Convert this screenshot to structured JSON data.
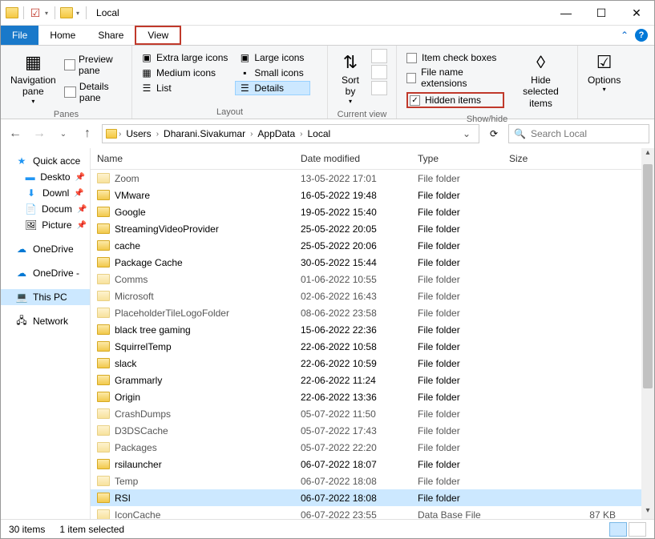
{
  "window_title": "Local",
  "menu": {
    "file": "File",
    "home": "Home",
    "share": "Share",
    "view": "View"
  },
  "ribbon": {
    "panes": {
      "navpane": "Navigation\npane",
      "preview": "Preview pane",
      "details": "Details pane",
      "group": "Panes"
    },
    "layout": {
      "xlarge": "Extra large icons",
      "large": "Large icons",
      "medium": "Medium icons",
      "small": "Small icons",
      "list": "List",
      "details": "Details",
      "group": "Layout"
    },
    "current": {
      "sort": "Sort\nby",
      "group": "Current view"
    },
    "showhide": {
      "itemcheck": "Item check boxes",
      "extensions": "File name extensions",
      "hidden": "Hidden items",
      "hideselected": "Hide selected\nitems",
      "group": "Show/hide"
    },
    "options": "Options"
  },
  "breadcrumb": [
    "Users",
    "Dharani.Sivakumar",
    "AppData",
    "Local"
  ],
  "search_placeholder": "Search Local",
  "sidebar": {
    "quick": "Quick acce",
    "quick_items": [
      "Deskto",
      "Downl",
      "Docum",
      "Picture"
    ],
    "onedrive1": "OneDrive",
    "onedrive2": "OneDrive -",
    "thispc": "This PC",
    "network": "Network"
  },
  "columns": {
    "name": "Name",
    "date": "Date modified",
    "type": "Type",
    "size": "Size"
  },
  "files": [
    {
      "name": "Zoom",
      "date": "13-05-2022 17:01",
      "type": "File folder",
      "size": "",
      "faded": true
    },
    {
      "name": "VMware",
      "date": "16-05-2022 19:48",
      "type": "File folder",
      "size": ""
    },
    {
      "name": "Google",
      "date": "19-05-2022 15:40",
      "type": "File folder",
      "size": ""
    },
    {
      "name": "StreamingVideoProvider",
      "date": "25-05-2022 20:05",
      "type": "File folder",
      "size": ""
    },
    {
      "name": "cache",
      "date": "25-05-2022 20:06",
      "type": "File folder",
      "size": ""
    },
    {
      "name": "Package Cache",
      "date": "30-05-2022 15:44",
      "type": "File folder",
      "size": ""
    },
    {
      "name": "Comms",
      "date": "01-06-2022 10:55",
      "type": "File folder",
      "size": "",
      "faded": true
    },
    {
      "name": "Microsoft",
      "date": "02-06-2022 16:43",
      "type": "File folder",
      "size": "",
      "faded": true
    },
    {
      "name": "PlaceholderTileLogoFolder",
      "date": "08-06-2022 23:58",
      "type": "File folder",
      "size": "",
      "faded": true
    },
    {
      "name": "black tree gaming",
      "date": "15-06-2022 22:36",
      "type": "File folder",
      "size": ""
    },
    {
      "name": "SquirrelTemp",
      "date": "22-06-2022 10:58",
      "type": "File folder",
      "size": ""
    },
    {
      "name": "slack",
      "date": "22-06-2022 10:59",
      "type": "File folder",
      "size": ""
    },
    {
      "name": "Grammarly",
      "date": "22-06-2022 11:24",
      "type": "File folder",
      "size": ""
    },
    {
      "name": "Origin",
      "date": "22-06-2022 13:36",
      "type": "File folder",
      "size": ""
    },
    {
      "name": "CrashDumps",
      "date": "05-07-2022 11:50",
      "type": "File folder",
      "size": "",
      "faded": true
    },
    {
      "name": "D3DSCache",
      "date": "05-07-2022 17:43",
      "type": "File folder",
      "size": "",
      "faded": true
    },
    {
      "name": "Packages",
      "date": "05-07-2022 22:20",
      "type": "File folder",
      "size": "",
      "faded": true
    },
    {
      "name": "rsilauncher",
      "date": "06-07-2022 18:07",
      "type": "File folder",
      "size": ""
    },
    {
      "name": "Temp",
      "date": "06-07-2022 18:08",
      "type": "File folder",
      "size": "",
      "faded": true
    },
    {
      "name": "RSI",
      "date": "06-07-2022 18:08",
      "type": "File folder",
      "size": "",
      "selected": true
    },
    {
      "name": "IconCache",
      "date": "06-07-2022 23:55",
      "type": "Data Base File",
      "size": "87 KB",
      "faded": true
    }
  ],
  "status": {
    "count": "30 items",
    "selection": "1 item selected"
  }
}
